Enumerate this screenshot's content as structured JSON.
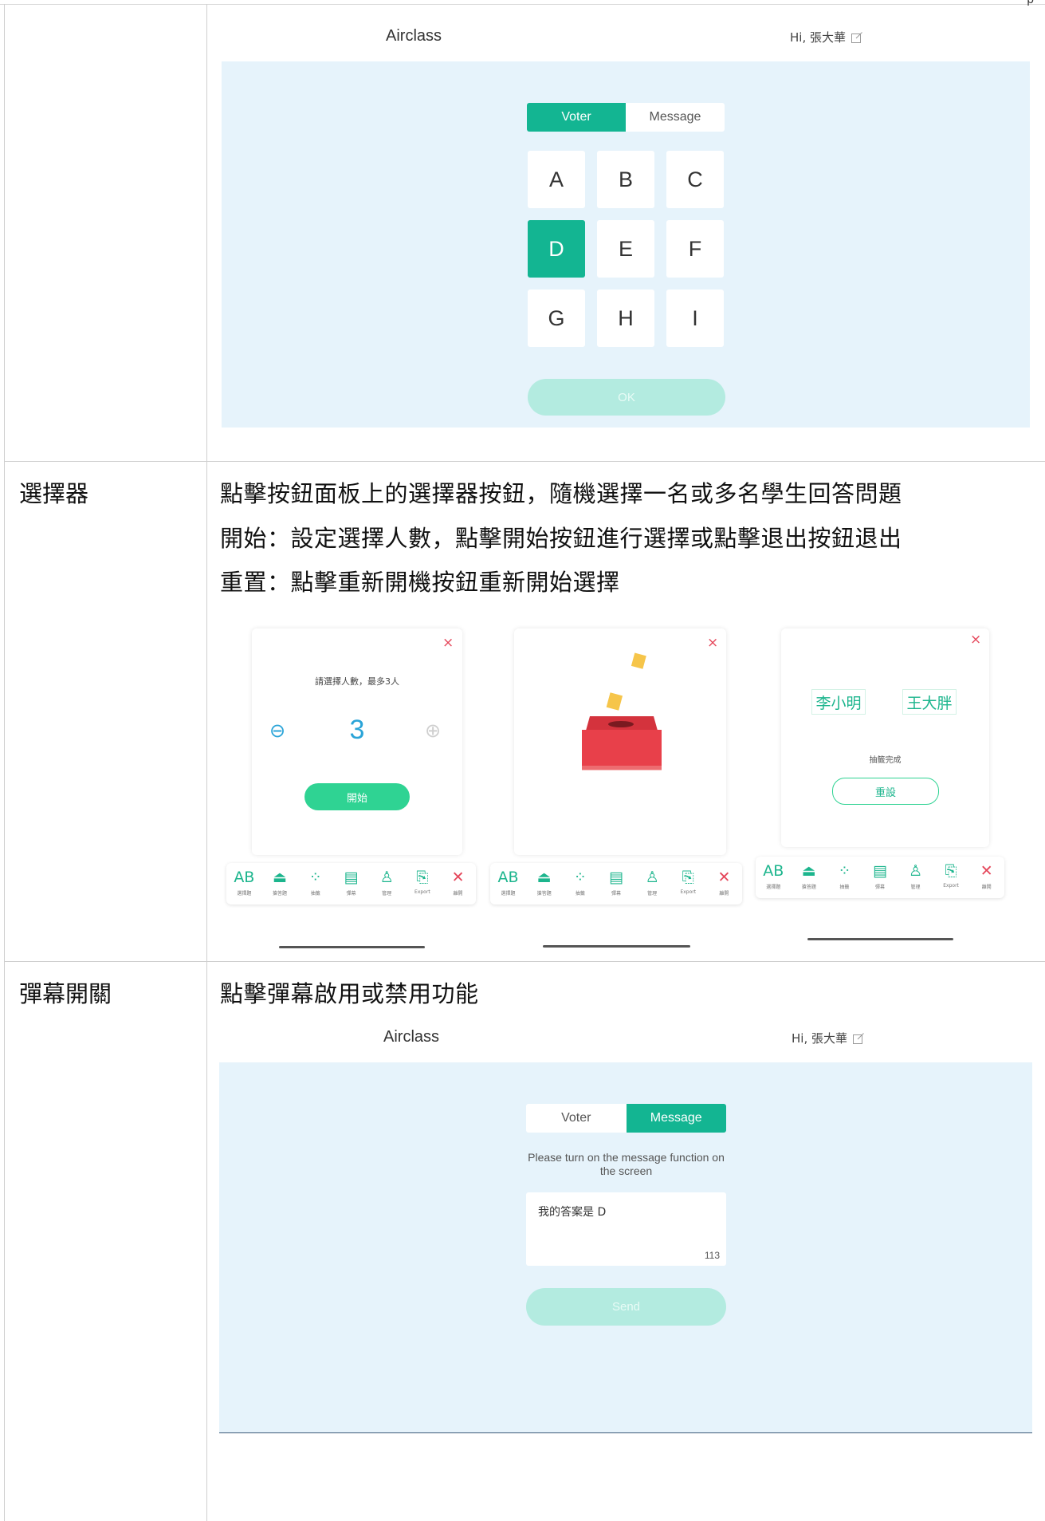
{
  "corner_mark": "p",
  "voter_screen": {
    "app_title": "Airclass",
    "greeting": "Hi, 張大華",
    "tabs": [
      "Voter",
      "Message"
    ],
    "active_tab": "Voter",
    "keys": [
      "A",
      "B",
      "C",
      "D",
      "E",
      "F",
      "G",
      "H",
      "I"
    ],
    "selected_key": "D",
    "ok_label": "OK"
  },
  "chooser_section": {
    "label": "選擇器",
    "desc_lines": [
      "點擊按鈕面板上的選擇器按鈕，隨機選擇一名或多名學生回答問題",
      "開始：設定選擇人數，點擊開始按鈕進行選擇或點擊退出按鈕退出",
      "重置：點擊重新開機按鈕重新開始選擇"
    ],
    "card1": {
      "close": "×",
      "prompt": "請選擇人數，最多3人",
      "minus": "⊖",
      "count": "3",
      "plus": "⊕",
      "start_label": "開始"
    },
    "card2": {
      "close": "×"
    },
    "card3": {
      "close": "×",
      "names": [
        "李小明",
        "王大胖"
      ],
      "done_text": "抽籤完成",
      "reset_label": "重設"
    },
    "toolbar1": [
      {
        "icon": "abcd-icon",
        "glyph": "AB",
        "label": "選擇題"
      },
      {
        "icon": "bell-icon",
        "glyph": "⏏",
        "label": "搶答題"
      },
      {
        "icon": "draw-icon",
        "glyph": "⁘",
        "label": "抽籤"
      },
      {
        "icon": "danmaku-icon",
        "glyph": "▤",
        "label": "彈幕"
      },
      {
        "icon": "manage-icon",
        "glyph": "♙",
        "label": "管理"
      },
      {
        "icon": "export-icon",
        "glyph": "⎘",
        "label": "Export"
      },
      {
        "icon": "close-icon",
        "glyph": "✕",
        "label": "離開"
      }
    ],
    "toolbar2": [
      {
        "icon": "abcd-icon",
        "glyph": "AB",
        "label": "選擇題"
      },
      {
        "icon": "bell-icon",
        "glyph": "⏏",
        "label": "搶答題"
      },
      {
        "icon": "draw-icon",
        "glyph": "⁘",
        "label": "抽籤"
      },
      {
        "icon": "danmaku-icon",
        "glyph": "▤",
        "label": "彈幕"
      },
      {
        "icon": "manage-icon",
        "glyph": "♙",
        "label": "管理"
      },
      {
        "icon": "export-icon",
        "glyph": "⎘",
        "label": "Export"
      },
      {
        "icon": "close-icon",
        "glyph": "✕",
        "label": "離開"
      }
    ],
    "toolbar3": [
      {
        "icon": "abcd-icon",
        "glyph": "AB",
        "label": "選擇題"
      },
      {
        "icon": "bell-icon",
        "glyph": "⏏",
        "label": "搶答題"
      },
      {
        "icon": "draw-icon",
        "glyph": "⁘",
        "label": "抽籤"
      },
      {
        "icon": "danmaku-icon",
        "glyph": "▤",
        "label": "彈幕"
      },
      {
        "icon": "manage-icon",
        "glyph": "♙",
        "label": "管理"
      },
      {
        "icon": "export-icon",
        "glyph": "⎘",
        "label": "Export"
      },
      {
        "icon": "close-icon",
        "glyph": "✕",
        "label": "離開"
      }
    ]
  },
  "danmaku_section": {
    "label": "彈幕開關",
    "desc": "點擊彈幕啟用或禁用功能",
    "app_title": "Airclass",
    "greeting": "Hi, 張大華",
    "tabs": [
      "Voter",
      "Message"
    ],
    "active_tab": "Message",
    "hint": "Please turn on the message function on the screen",
    "message_value": "我的答案是 D",
    "char_count": "113",
    "send_label": "Send"
  },
  "colors": {
    "accent": "#13b592",
    "panel_bg": "#e6f3fb",
    "close_red": "#e5475b",
    "box_red": "#e8404a"
  }
}
